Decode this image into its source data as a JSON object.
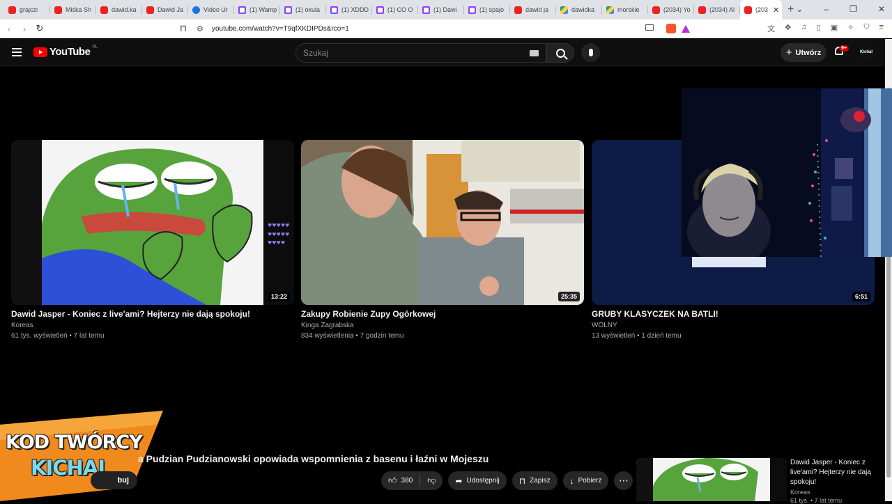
{
  "browser": {
    "tabs": [
      {
        "label": "grajczi",
        "icon": "youtube-icon"
      },
      {
        "label": "Miśka Sh",
        "icon": "youtube-icon"
      },
      {
        "label": "dawid.ka",
        "icon": "youtube-icon"
      },
      {
        "label": "Dawid Ja",
        "icon": "youtube-icon"
      },
      {
        "label": "Video Ur",
        "icon": "video-icon"
      },
      {
        "label": "(1) Wamp",
        "icon": "twitch-icon"
      },
      {
        "label": "(1) okula",
        "icon": "twitch-icon"
      },
      {
        "label": "(1) XDDD",
        "icon": "twitch-icon"
      },
      {
        "label": "(1) CO O",
        "icon": "twitch-icon"
      },
      {
        "label": "(1) Dawi",
        "icon": "twitch-icon"
      },
      {
        "label": "(1) spajo",
        "icon": "twitch-icon"
      },
      {
        "label": "dawid ja",
        "icon": "youtube-icon"
      },
      {
        "label": "dawidka",
        "icon": "drive-icon"
      },
      {
        "label": "morskie",
        "icon": "drive-icon"
      },
      {
        "label": "(2034) Yo",
        "icon": "youtube-icon"
      },
      {
        "label": "(2034) Al",
        "icon": "youtube-icon"
      },
      {
        "label": "(203",
        "icon": "youtube-icon",
        "active": true
      }
    ],
    "url": "youtube.com/watch?v=T9qfXKDIPDs&rco=1"
  },
  "header": {
    "logo_text": "YouTube",
    "logo_country": "PL",
    "search_placeholder": "Szukaj",
    "create_label": "Utwórz",
    "notifications_badge": "9+",
    "avatar_text": "Kichal"
  },
  "videos": [
    {
      "title": "Dawid Jasper - Koniec z live'ami? Hejterzy nie dają spokoju!",
      "channel": "Koreas",
      "meta": "61 tys. wyświetleń • 7 lat temu",
      "duration": "13:22"
    },
    {
      "title": "Zakupy Robienie Zupy Ogórkowej",
      "channel": "Kinga Zagrabska",
      "meta": "834 wyświetlenia • 7 godzin temu",
      "duration": "25:35"
    },
    {
      "title": "GRUBY KLASYCZEK NA BATLI!",
      "channel": "WOLNY",
      "meta": "13 wyświetleń • 1 dzień temu",
      "duration": "6:51"
    }
  ],
  "overlay": {
    "line1": "KOD TWÓRCY",
    "line2": "KICHAL"
  },
  "watch": {
    "title": "a Pudzian Pudzianowski opowiada wspomnienia z basenu i łaźni w Mojeszu",
    "subscribe_label": "buj",
    "likes": "380",
    "share_label": "Udostępnij",
    "save_label": "Zapisz",
    "download_label": "Pobierz"
  },
  "related": {
    "title": "Dawid Jasper - Koniec z live'ami? Hejterzy nie dają spokoju!",
    "channel": "Koreas",
    "meta": "61 tys. • 7 lat temu"
  }
}
